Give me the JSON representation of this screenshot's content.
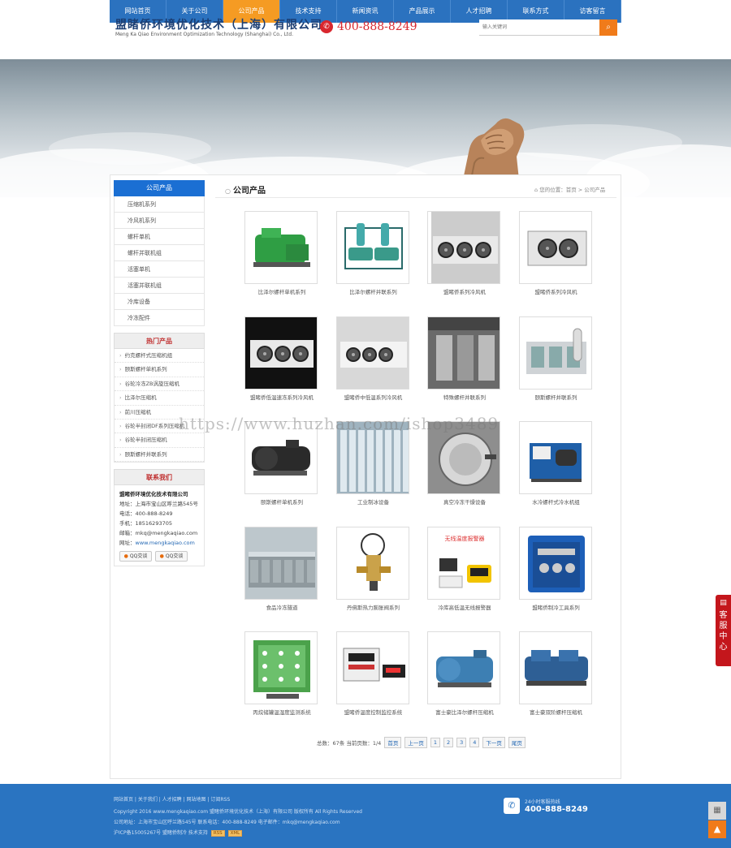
{
  "nav": {
    "items": [
      "网站首页",
      "关于公司",
      "公司产品",
      "技术支持",
      "新闻资讯",
      "产品展示",
      "人才招聘",
      "联系方式",
      "访客留言"
    ],
    "active_index": 2
  },
  "header": {
    "company_cn": "盟睹侨环境优化技术（上海）有限公司",
    "company_en": "Meng Ka Qiao Environment Optimization Technology (Shanghai) Co., Ltd.",
    "hotline": "400-888-8249",
    "search_placeholder": "输入关键词"
  },
  "sidebar": {
    "products_title": "公司产品",
    "categories": [
      "压缩机系列",
      "冷风机系列",
      "螺杆单机",
      "螺杆并联机组",
      "活塞单机",
      "活塞并联机组",
      "冷库设备",
      "冷冻配件"
    ],
    "hot_title": "热门产品",
    "hot_items": [
      "约克螺杆式压缩机组",
      "颐斯螺杆单机系列",
      "谷轮冷冻ZB涡旋压缩机",
      "比泽尔压缩机",
      "前川压缩机",
      "谷轮半封闭DF系列压缩机",
      "谷轮半封闭压缩机",
      "颐斯螺杆并联系列"
    ],
    "contact_title": "联系我们",
    "contact": {
      "company": "盟睹侨环境优化技术有限公司",
      "address": "地址：上海市宝山区呼兰路545号",
      "phone": "电话：400-888-8249",
      "mobile": "手机：18516293705",
      "email": "邮箱：mkq@mengkaqiao.com",
      "site_label": "网址：",
      "site": "www.mengkaqiao.com",
      "qq1": "QQ交谈",
      "qq2": "QQ交谈"
    }
  },
  "main": {
    "title": "公司产品",
    "breadcrumb": "您的位置：首页 > 公司产品"
  },
  "products": [
    {
      "name": "比泽尔螺杆单机系列",
      "kind": "green"
    },
    {
      "name": "比泽尔螺杆并联系列",
      "kind": "teal"
    },
    {
      "name": "盟睹侨系列冷风机",
      "kind": "coolerw"
    },
    {
      "name": "盟睹侨系列冷风机",
      "kind": "cooler"
    },
    {
      "name": "盟睹侨低温速冻系列冷风机",
      "kind": "coolerdark"
    },
    {
      "name": "盟睹侨中低温系列冷风机",
      "kind": "coolerwide"
    },
    {
      "name": "特殊螺杆并联系列",
      "kind": "rackdark"
    },
    {
      "name": "颐斯螺杆并联系列",
      "kind": "rackgrey"
    },
    {
      "name": "颐斯螺杆单机系列",
      "kind": "compdark"
    },
    {
      "name": "工业制冰设备",
      "kind": "ice"
    },
    {
      "name": "真空冷冻干燥设备",
      "kind": "vacuum"
    },
    {
      "name": "水冷螺杆式冷水机组",
      "kind": "chiller"
    },
    {
      "name": "食品冷冻隧道",
      "kind": "tunnel"
    },
    {
      "name": "丹佛斯热力膨胀阀系列",
      "kind": "valve"
    },
    {
      "name": "冷库高低温无线报警器",
      "kind": "alarm"
    },
    {
      "name": "盟睹侨制冷工具系列",
      "kind": "toolbox"
    },
    {
      "name": "丙烷储罐温湿度监测系统",
      "kind": "panel"
    },
    {
      "name": "盟睹侨温度控制监控系统",
      "kind": "controller"
    },
    {
      "name": "富士豪比泽尔螺杆压缩机",
      "kind": "screwblue"
    },
    {
      "name": "富士豪双阶螺杆压缩机",
      "kind": "screwtwin"
    }
  ],
  "pager": {
    "summary": "总数：67条  当前页数：1/4",
    "first": "首页",
    "prev": "上一页",
    "pages": [
      "1",
      "2",
      "3",
      "4"
    ],
    "next": "下一页",
    "last": "尾页"
  },
  "watermark": "https://www.huzhan.com/ishop3489",
  "footer": {
    "links": "网站首页 | 关于我们 | 人才招聘 | 网站地图 | 订阅RSS",
    "copyright": "Copyright 2016 www.mengkaqiao.com 盟睹侨环境优化技术（上海）有限公司 版权所有 All Rights Reserved",
    "address": "公司地址：上海市宝山区呼兰路545号 联系电话：400-888-8249 电子邮件：mkq@mengkaqiao.com",
    "icp": "沪ICP备15005267号 盟睹侨制冷 技术支持",
    "rss": "RSS",
    "xml": "XML",
    "hotline_label": "24小时客服热线",
    "hotline": "400-888-8249"
  },
  "service": "客服中心",
  "colors": {
    "nav": "#2b72bf",
    "active": "#f59b23",
    "accent": "#1b6fd3",
    "footer": "#2a74c1",
    "service": "#c4161c"
  }
}
